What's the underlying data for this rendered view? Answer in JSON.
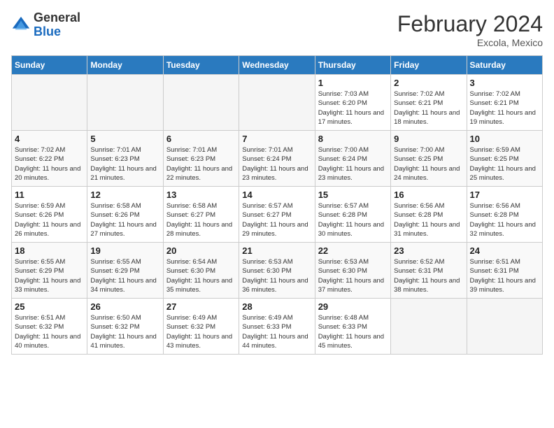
{
  "logo": {
    "general": "General",
    "blue": "Blue"
  },
  "title": "February 2024",
  "subtitle": "Excola, Mexico",
  "days_of_week": [
    "Sunday",
    "Monday",
    "Tuesday",
    "Wednesday",
    "Thursday",
    "Friday",
    "Saturday"
  ],
  "weeks": [
    [
      {
        "day": "",
        "info": ""
      },
      {
        "day": "",
        "info": ""
      },
      {
        "day": "",
        "info": ""
      },
      {
        "day": "",
        "info": ""
      },
      {
        "day": "1",
        "info": "Sunrise: 7:03 AM\nSunset: 6:20 PM\nDaylight: 11 hours\nand 17 minutes."
      },
      {
        "day": "2",
        "info": "Sunrise: 7:02 AM\nSunset: 6:21 PM\nDaylight: 11 hours\nand 18 minutes."
      },
      {
        "day": "3",
        "info": "Sunrise: 7:02 AM\nSunset: 6:21 PM\nDaylight: 11 hours\nand 19 minutes."
      }
    ],
    [
      {
        "day": "4",
        "info": "Sunrise: 7:02 AM\nSunset: 6:22 PM\nDaylight: 11 hours\nand 20 minutes."
      },
      {
        "day": "5",
        "info": "Sunrise: 7:01 AM\nSunset: 6:23 PM\nDaylight: 11 hours\nand 21 minutes."
      },
      {
        "day": "6",
        "info": "Sunrise: 7:01 AM\nSunset: 6:23 PM\nDaylight: 11 hours\nand 22 minutes."
      },
      {
        "day": "7",
        "info": "Sunrise: 7:01 AM\nSunset: 6:24 PM\nDaylight: 11 hours\nand 23 minutes."
      },
      {
        "day": "8",
        "info": "Sunrise: 7:00 AM\nSunset: 6:24 PM\nDaylight: 11 hours\nand 23 minutes."
      },
      {
        "day": "9",
        "info": "Sunrise: 7:00 AM\nSunset: 6:25 PM\nDaylight: 11 hours\nand 24 minutes."
      },
      {
        "day": "10",
        "info": "Sunrise: 6:59 AM\nSunset: 6:25 PM\nDaylight: 11 hours\nand 25 minutes."
      }
    ],
    [
      {
        "day": "11",
        "info": "Sunrise: 6:59 AM\nSunset: 6:26 PM\nDaylight: 11 hours\nand 26 minutes."
      },
      {
        "day": "12",
        "info": "Sunrise: 6:58 AM\nSunset: 6:26 PM\nDaylight: 11 hours\nand 27 minutes."
      },
      {
        "day": "13",
        "info": "Sunrise: 6:58 AM\nSunset: 6:27 PM\nDaylight: 11 hours\nand 28 minutes."
      },
      {
        "day": "14",
        "info": "Sunrise: 6:57 AM\nSunset: 6:27 PM\nDaylight: 11 hours\nand 29 minutes."
      },
      {
        "day": "15",
        "info": "Sunrise: 6:57 AM\nSunset: 6:28 PM\nDaylight: 11 hours\nand 30 minutes."
      },
      {
        "day": "16",
        "info": "Sunrise: 6:56 AM\nSunset: 6:28 PM\nDaylight: 11 hours\nand 31 minutes."
      },
      {
        "day": "17",
        "info": "Sunrise: 6:56 AM\nSunset: 6:28 PM\nDaylight: 11 hours\nand 32 minutes."
      }
    ],
    [
      {
        "day": "18",
        "info": "Sunrise: 6:55 AM\nSunset: 6:29 PM\nDaylight: 11 hours\nand 33 minutes."
      },
      {
        "day": "19",
        "info": "Sunrise: 6:55 AM\nSunset: 6:29 PM\nDaylight: 11 hours\nand 34 minutes."
      },
      {
        "day": "20",
        "info": "Sunrise: 6:54 AM\nSunset: 6:30 PM\nDaylight: 11 hours\nand 35 minutes."
      },
      {
        "day": "21",
        "info": "Sunrise: 6:53 AM\nSunset: 6:30 PM\nDaylight: 11 hours\nand 36 minutes."
      },
      {
        "day": "22",
        "info": "Sunrise: 6:53 AM\nSunset: 6:30 PM\nDaylight: 11 hours\nand 37 minutes."
      },
      {
        "day": "23",
        "info": "Sunrise: 6:52 AM\nSunset: 6:31 PM\nDaylight: 11 hours\nand 38 minutes."
      },
      {
        "day": "24",
        "info": "Sunrise: 6:51 AM\nSunset: 6:31 PM\nDaylight: 11 hours\nand 39 minutes."
      }
    ],
    [
      {
        "day": "25",
        "info": "Sunrise: 6:51 AM\nSunset: 6:32 PM\nDaylight: 11 hours\nand 40 minutes."
      },
      {
        "day": "26",
        "info": "Sunrise: 6:50 AM\nSunset: 6:32 PM\nDaylight: 11 hours\nand 41 minutes."
      },
      {
        "day": "27",
        "info": "Sunrise: 6:49 AM\nSunset: 6:32 PM\nDaylight: 11 hours\nand 43 minutes."
      },
      {
        "day": "28",
        "info": "Sunrise: 6:49 AM\nSunset: 6:33 PM\nDaylight: 11 hours\nand 44 minutes."
      },
      {
        "day": "29",
        "info": "Sunrise: 6:48 AM\nSunset: 6:33 PM\nDaylight: 11 hours\nand 45 minutes."
      },
      {
        "day": "",
        "info": ""
      },
      {
        "day": "",
        "info": ""
      }
    ]
  ]
}
